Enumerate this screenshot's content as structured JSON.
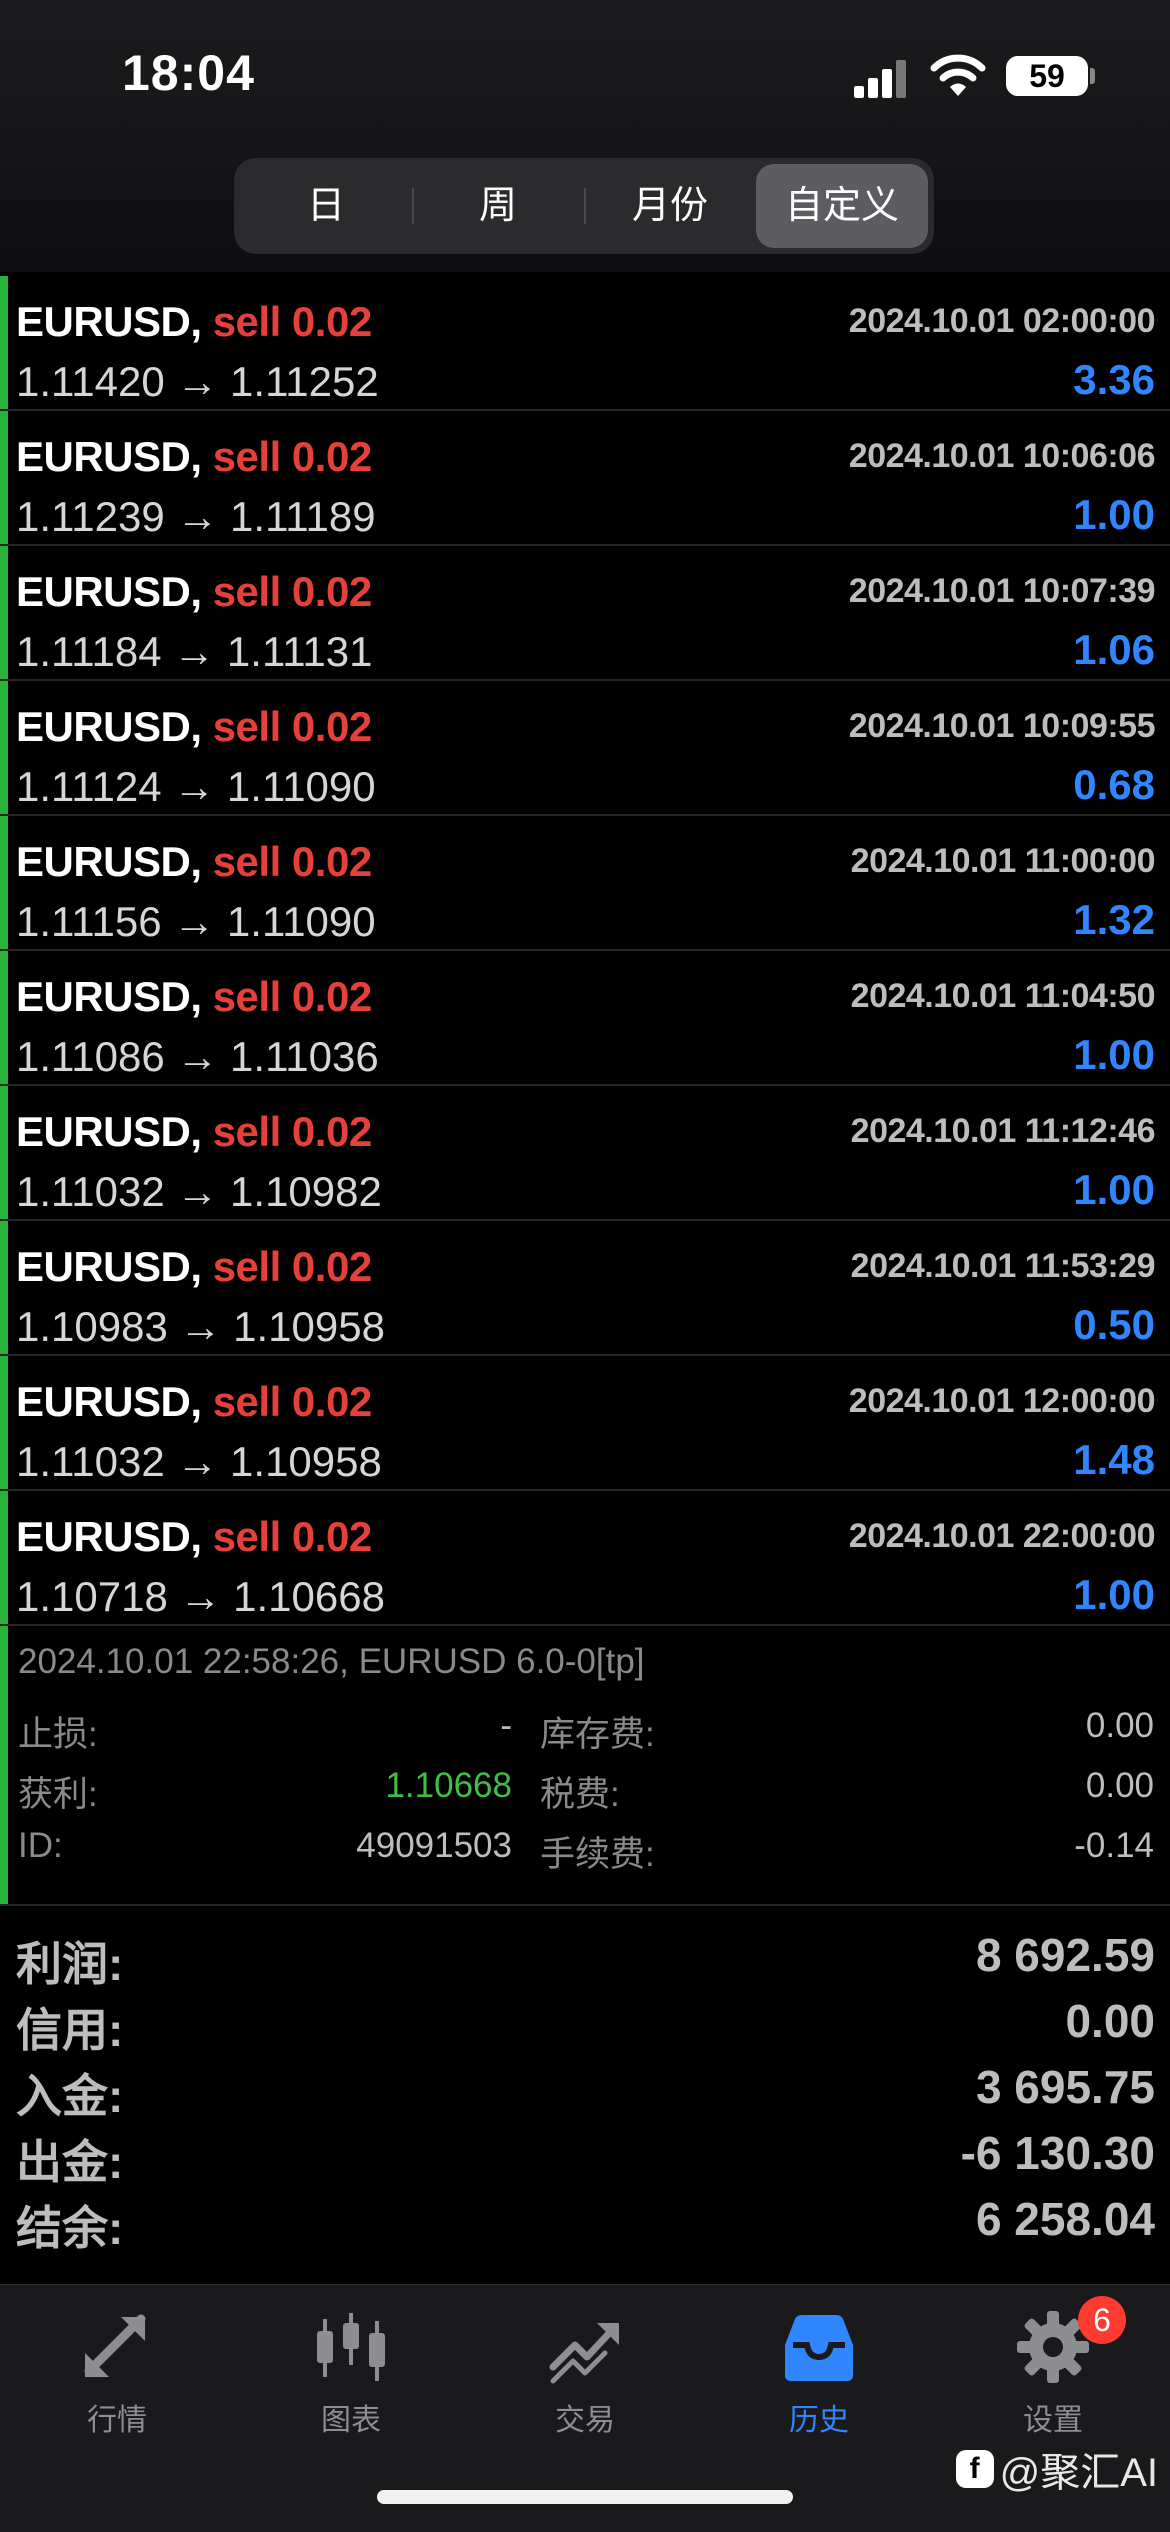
{
  "status_bar": {
    "time": "18:04",
    "battery": "59"
  },
  "period_tabs": [
    {
      "label": "日",
      "active": false
    },
    {
      "label": "周",
      "active": false
    },
    {
      "label": "月份",
      "active": false
    },
    {
      "label": "自定义",
      "active": true
    }
  ],
  "deals": [
    {
      "symbol": "EURUSD,",
      "side": "sell 0.02",
      "datetime": "2024.10.01 02:00:00",
      "prices": "1.11420 → 1.11252",
      "profit": "3.36"
    },
    {
      "symbol": "EURUSD,",
      "side": "sell 0.02",
      "datetime": "2024.10.01 10:06:06",
      "prices": "1.11239 → 1.11189",
      "profit": "1.00"
    },
    {
      "symbol": "EURUSD,",
      "side": "sell 0.02",
      "datetime": "2024.10.01 10:07:39",
      "prices": "1.11184 → 1.11131",
      "profit": "1.06"
    },
    {
      "symbol": "EURUSD,",
      "side": "sell 0.02",
      "datetime": "2024.10.01 10:09:55",
      "prices": "1.11124 → 1.11090",
      "profit": "0.68"
    },
    {
      "symbol": "EURUSD,",
      "side": "sell 0.02",
      "datetime": "2024.10.01 11:00:00",
      "prices": "1.11156 → 1.11090",
      "profit": "1.32"
    },
    {
      "symbol": "EURUSD,",
      "side": "sell 0.02",
      "datetime": "2024.10.01 11:04:50",
      "prices": "1.11086 → 1.11036",
      "profit": "1.00"
    },
    {
      "symbol": "EURUSD,",
      "side": "sell 0.02",
      "datetime": "2024.10.01 11:12:46",
      "prices": "1.11032 → 1.10982",
      "profit": "1.00"
    },
    {
      "symbol": "EURUSD,",
      "side": "sell 0.02",
      "datetime": "2024.10.01 11:53:29",
      "prices": "1.10983 → 1.10958",
      "profit": "0.50"
    },
    {
      "symbol": "EURUSD,",
      "side": "sell 0.02",
      "datetime": "2024.10.01 12:00:00",
      "prices": "1.11032 → 1.10958",
      "profit": "1.48"
    },
    {
      "symbol": "EURUSD,",
      "side": "sell 0.02",
      "datetime": "2024.10.01 22:00:00",
      "prices": "1.10718 → 1.10668",
      "profit": "1.00"
    }
  ],
  "detail": {
    "header": "2024.10.01 22:58:26, EURUSD 6.0-0[tp]",
    "stop_loss_label": "止损:",
    "stop_loss_value": "-",
    "take_profit_label": "获利:",
    "take_profit_value": "1.10668",
    "id_label": "ID:",
    "id_value": "49091503",
    "swap_label": "库存费:",
    "swap_value": "0.00",
    "tax_label": "税费:",
    "tax_value": "0.00",
    "commission_label": "手续费:",
    "commission_value": "-0.14"
  },
  "summary": [
    {
      "label": "利润:",
      "value": "8 692.59"
    },
    {
      "label": "信用:",
      "value": "0.00"
    },
    {
      "label": "入金:",
      "value": "3 695.75"
    },
    {
      "label": "出金:",
      "value": "-6 130.30"
    },
    {
      "label": "结余:",
      "value": "6 258.04"
    }
  ],
  "tabbar": {
    "quotes": "行情",
    "charts": "图表",
    "trade": "交易",
    "history": "历史",
    "settings": "设置",
    "settings_badge": "6"
  },
  "watermark": "@聚汇AI",
  "colors": {
    "sell": "#e5403a",
    "profit": "#2f86ff",
    "accent_bar": "#27b33c",
    "active_tab": "#2f86ff"
  },
  "icons": [
    "signal-icon",
    "wifi-icon",
    "battery-icon",
    "quotes-arrows-icon",
    "candlestick-chart-icon",
    "trade-trend-icon",
    "history-inbox-icon",
    "settings-gear-icon"
  ]
}
